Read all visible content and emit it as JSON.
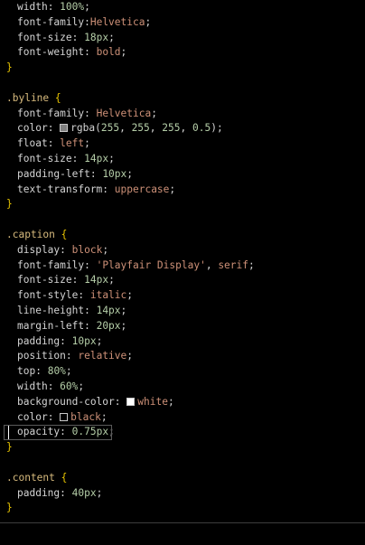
{
  "editor": {
    "lines": {
      "l1": {
        "prop": "width",
        "val": "100%"
      },
      "l2": {
        "prop": "font-family",
        "val": "Helvetica"
      },
      "l3": {
        "prop": "font-size",
        "val": "18px"
      },
      "l4": {
        "prop": "font-weight",
        "val": "bold"
      },
      "l5": {
        "brace": "}"
      },
      "l7": {
        "selector": ".byline",
        "brace": "{"
      },
      "l8": {
        "prop": "font-family",
        "val": "Helvetica"
      },
      "l9": {
        "prop": "color",
        "fn": "rgba(",
        "n1": "255",
        "n2": "255",
        "n3": "255",
        "n4": "0.5",
        "close": ")"
      },
      "l10": {
        "prop": "float",
        "val": "left"
      },
      "l11": {
        "prop": "font-size",
        "val": "14px"
      },
      "l12": {
        "prop": "padding-left",
        "val": "10px"
      },
      "l13": {
        "prop": "text-transform",
        "val": "uppercase"
      },
      "l14": {
        "brace": "}"
      },
      "l16": {
        "selector": ".caption",
        "brace": "{"
      },
      "l17": {
        "prop": "display",
        "val": "block"
      },
      "l18": {
        "prop": "font-family",
        "str": "'Playfair Display'",
        "val": "serif"
      },
      "l19": {
        "prop": "font-size",
        "val": "14px"
      },
      "l20": {
        "prop": "font-style",
        "val": "italic"
      },
      "l21": {
        "prop": "line-height",
        "val": "14px"
      },
      "l22": {
        "prop": "margin-left",
        "val": "20px"
      },
      "l23": {
        "prop": "padding",
        "val": "10px"
      },
      "l24": {
        "prop": "position",
        "val": "relative"
      },
      "l25": {
        "prop": "top",
        "val": "80%"
      },
      "l26": {
        "prop": "width",
        "val": "60%"
      },
      "l27": {
        "prop": "background-color",
        "val": "white"
      },
      "l28": {
        "prop": "color",
        "val": "black"
      },
      "l29": {
        "prop": "opacity",
        "val": "0.75px"
      },
      "l30": {
        "brace": "}"
      },
      "l32": {
        "selector": ".content",
        "brace": "{"
      },
      "l33": {
        "prop": "padding",
        "val": "40px"
      },
      "l34": {
        "brace": "}"
      }
    },
    "swatches": {
      "gray": "#808080",
      "white": "#ffffff",
      "black": "#000000"
    }
  }
}
